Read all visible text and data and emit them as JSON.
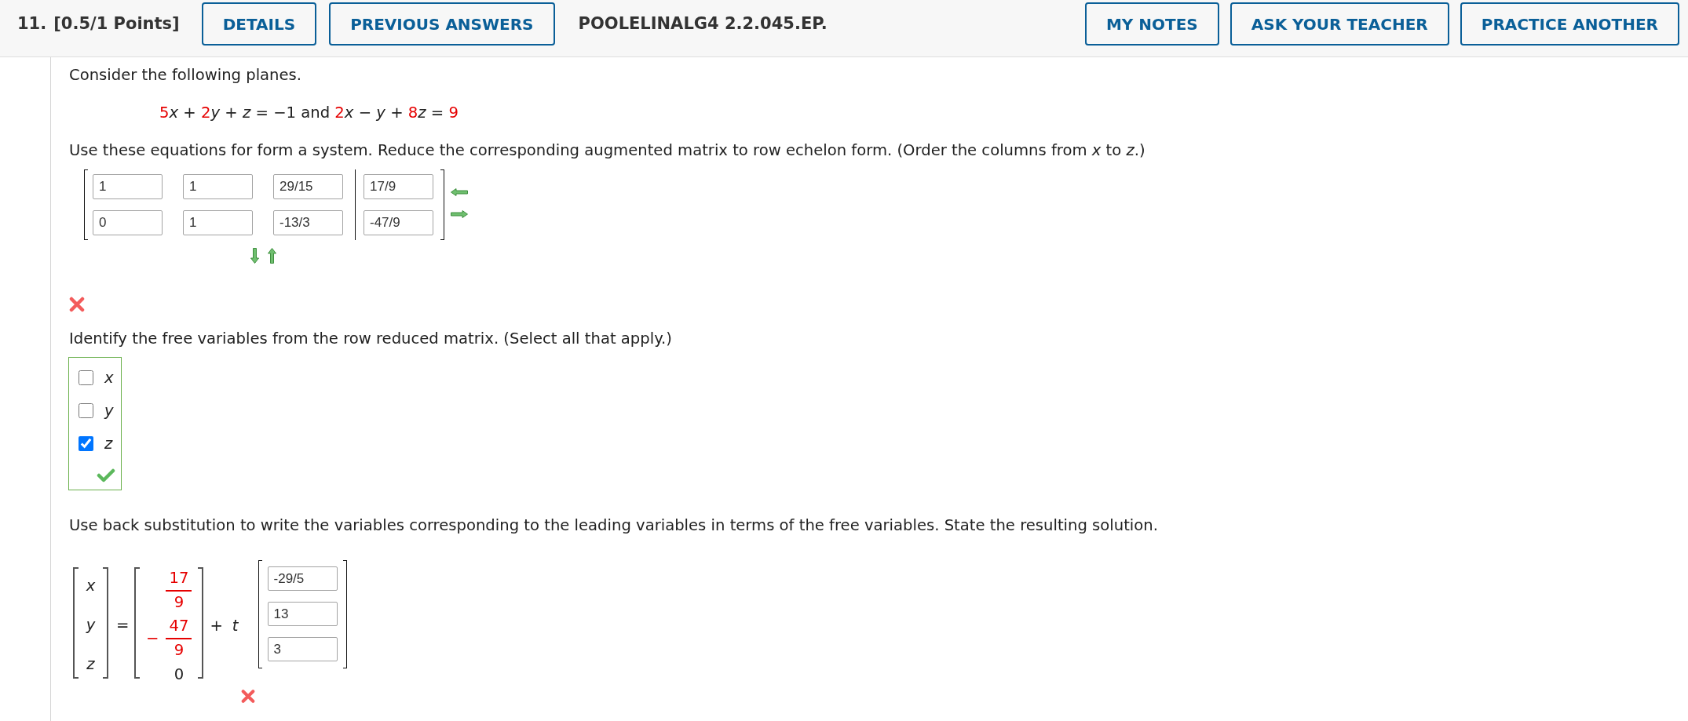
{
  "header": {
    "number": "11.",
    "points": "[0.5/1 Points]",
    "left_buttons": [
      "DETAILS",
      "PREVIOUS ANSWERS"
    ],
    "problem_code": "POOLELINALG4 2.2.045.EP.",
    "right_buttons": [
      "MY NOTES",
      "ASK YOUR TEACHER",
      "PRACTICE ANOTHER"
    ]
  },
  "intro": "Consider the following planes.",
  "equation": [
    {
      "kind": "given",
      "text": "5"
    },
    {
      "kind": "variable",
      "text": "x"
    },
    {
      "kind": "symbol",
      "text": "+"
    },
    {
      "kind": "given",
      "text": "2"
    },
    {
      "kind": "variable",
      "text": "y"
    },
    {
      "kind": "symbol",
      "text": "+"
    },
    {
      "kind": "variable",
      "text": "z"
    },
    {
      "kind": "symbol",
      "text": "="
    },
    {
      "kind": "symbol",
      "text": "−1"
    },
    {
      "kind": "symbol",
      "text": "and"
    },
    {
      "kind": "given",
      "text": "2"
    },
    {
      "kind": "variable",
      "text": "x"
    },
    {
      "kind": "symbol",
      "text": "−"
    },
    {
      "kind": "variable",
      "text": "y"
    },
    {
      "kind": "symbol",
      "text": "+"
    },
    {
      "kind": "given",
      "text": "8"
    },
    {
      "kind": "variable",
      "text": "z"
    },
    {
      "kind": "symbol",
      "text": "="
    },
    {
      "kind": "given",
      "text": "9"
    }
  ],
  "part_1": {
    "prompt": "Use these equations for form a system. Reduce the corresponding augmented matrix to row echelon form. (Order the columns from *x* to *z*.)",
    "matrix": {
      "rows": [
        {
          "coefficients": [
            "1",
            "1",
            "29/15"
          ],
          "constant": "17/9"
        },
        {
          "coefficients": [
            "0",
            "1",
            "-13/3"
          ],
          "constant": "-47/9"
        }
      ]
    },
    "correct": false
  },
  "part_2": {
    "prompt": "Identify the free variables from the row reduced matrix. (Select all that apply.)",
    "options": [
      {
        "label": "x",
        "checked": false
      },
      {
        "label": "y",
        "checked": false
      },
      {
        "label": "z",
        "checked": true
      }
    ],
    "correct": true
  },
  "part_3": {
    "prompt": "Use back substitution to write the variables corresponding to the leading variables in terms of the free variables. State the resulting solution.",
    "variables": [
      "x",
      "y",
      "z"
    ],
    "equals": "=",
    "particular": [
      {
        "kind": "fraction",
        "numerator": "17",
        "denominator": "9"
      },
      {
        "kind": "fraction",
        "sign": "−",
        "numerator": "47",
        "denominator": "9"
      },
      {
        "kind": "number",
        "text": "0"
      }
    ],
    "plus": "+",
    "parameter": "t",
    "direction": [
      "-29/5",
      "13",
      "3"
    ],
    "correct": false
  }
}
